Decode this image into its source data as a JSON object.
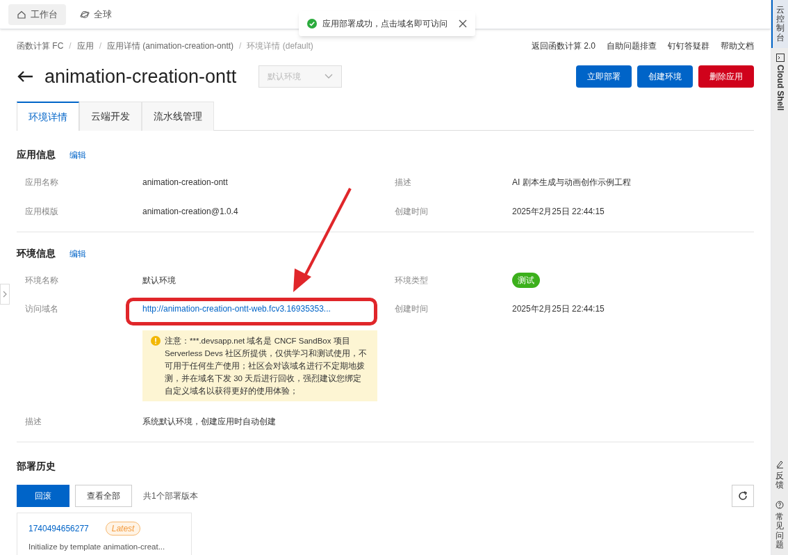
{
  "top_bar": {
    "items": [
      {
        "label": "工作台",
        "selected": true
      },
      {
        "label": "全球",
        "selected": false
      }
    ]
  },
  "toast": {
    "message": "应用部署成功，点击域名即可访问"
  },
  "breadcrumb": {
    "separator": "/",
    "items": [
      "函数计算 FC",
      "应用",
      "应用详情 (animation-creation-ontt)",
      "环境详情 (default)"
    ]
  },
  "header_links": [
    "返回函数计算 2.0",
    "自助问题排查",
    "钉钉答疑群",
    "帮助文档"
  ],
  "title": "animation-creation-ontt",
  "env_select": {
    "placeholder": "默认环境"
  },
  "actions": [
    {
      "label": "立即部署",
      "kind": "primary"
    },
    {
      "label": "创建环境",
      "kind": "primary"
    },
    {
      "label": "删除应用",
      "kind": "danger"
    }
  ],
  "tabs": [
    {
      "label": "环境详情",
      "selected": true
    },
    {
      "label": "云端开发",
      "selected": false
    },
    {
      "label": "流水线管理",
      "selected": false
    }
  ],
  "app_info": {
    "title": "应用信息",
    "edit": "编辑",
    "fields": [
      {
        "label": "应用名称",
        "value": "animation-creation-ontt"
      },
      {
        "label": "描述",
        "value": "AI 剧本生成与动画创作示例工程"
      },
      {
        "label": "应用模版",
        "value": "animation-creation@1.0.4"
      },
      {
        "label": "创建时间",
        "value": "2025年2月25日 22:44:15"
      }
    ]
  },
  "env_info": {
    "title": "环境信息",
    "edit": "编辑",
    "name_label": "环境名称",
    "name": "默认环境",
    "type_label": "环境类型",
    "type_tag": "测试",
    "domain_label": "访问域名",
    "domain": "http://animation-creation-ontt-web.fcv3.16935353...",
    "created_label": "创建时间",
    "created": "2025年2月25日 22:44:15",
    "notice": "注意：***.devsapp.net 域名是 CNCF SandBox 项目 Serverless Devs 社区所提供，仅供学习和测试使用，不可用于任何生产使用；社区会对该域名进行不定期地拨测，并在域名下发 30 天后进行回收，强烈建议您绑定自定义域名以获得更好的使用体验；",
    "desc_label": "描述",
    "desc": "系统默认环境，创建应用时自动创建"
  },
  "deploy_history": {
    "title": "部署历史",
    "rollback": "回滚",
    "view_all": "查看全部",
    "count": "共1个部署版本",
    "versions": [
      {
        "id": "1740494656277",
        "tag": "Latest",
        "message": "Initialize by template animation-creat..."
      }
    ]
  },
  "side_rail": {
    "top": [
      {
        "label": "云控制台",
        "selected": true
      },
      {
        "label": "Cloud Shell",
        "selected": false
      }
    ],
    "bottom": [
      "反馈",
      "常见问题"
    ]
  }
}
